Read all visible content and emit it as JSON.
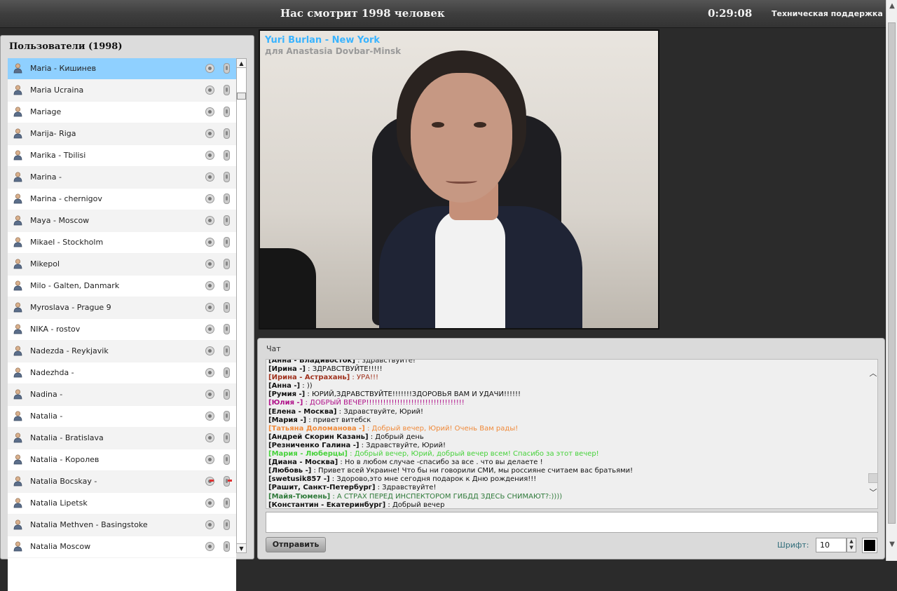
{
  "header": {
    "viewers": "Нас смотрит 1998 человек",
    "timer": "0:29:08",
    "support": "Техническая поддержка"
  },
  "users_panel": {
    "title": "Пользователи (1998)",
    "users": [
      {
        "name": "Maria - Кишинев",
        "selected": true,
        "banned": false
      },
      {
        "name": "Maria Ucraina",
        "selected": false,
        "banned": false
      },
      {
        "name": "Mariage",
        "selected": false,
        "banned": false
      },
      {
        "name": "Marija- Riga",
        "selected": false,
        "banned": false
      },
      {
        "name": "Marika - Tbilisi",
        "selected": false,
        "banned": false
      },
      {
        "name": "Marina -",
        "selected": false,
        "banned": false
      },
      {
        "name": "Marina - chernigov",
        "selected": false,
        "banned": false
      },
      {
        "name": "Maya - Moscow",
        "selected": false,
        "banned": false
      },
      {
        "name": "Mikael - Stockholm",
        "selected": false,
        "banned": false
      },
      {
        "name": "Mikepol",
        "selected": false,
        "banned": false
      },
      {
        "name": "Milo - Galten, Danmark",
        "selected": false,
        "banned": false
      },
      {
        "name": "Myroslava - Prague 9",
        "selected": false,
        "banned": false
      },
      {
        "name": "NIKA - rostov",
        "selected": false,
        "banned": false
      },
      {
        "name": "Nadezda - Reykjavik",
        "selected": false,
        "banned": false
      },
      {
        "name": "Nadezhda -",
        "selected": false,
        "banned": false
      },
      {
        "name": "Nadina -",
        "selected": false,
        "banned": false
      },
      {
        "name": "Natalia -",
        "selected": false,
        "banned": false
      },
      {
        "name": "Natalia - Bratislava",
        "selected": false,
        "banned": false
      },
      {
        "name": "Natalia - Королев",
        "selected": false,
        "banned": false
      },
      {
        "name": "Natalia Bocskay -",
        "selected": false,
        "banned": true
      },
      {
        "name": "Natalia Lipetsk",
        "selected": false,
        "banned": false
      },
      {
        "name": "Natalia Methven - Basingstoke",
        "selected": false,
        "banned": false
      },
      {
        "name": "Natalia Moscow",
        "selected": false,
        "banned": false
      }
    ]
  },
  "video": {
    "broadcaster": "Yuri Burlan - New York",
    "recipient": "для Anastasia Dovbar-Minsk"
  },
  "chat": {
    "title": "Чат",
    "messages": [
      {
        "who": "[Анна - Владивосток]",
        "text": "здравствуйте!",
        "color": "#111111"
      },
      {
        "who": "[Ирина -]",
        "text": "ЗДРАВСТВУЙТЕ!!!!!",
        "color": "#111111"
      },
      {
        "who": "[Ирина - Астрахань]",
        "text": "УРА!!!",
        "color": "#a0321e"
      },
      {
        "who": "[Анна -]",
        "text": "))",
        "color": "#111111"
      },
      {
        "who": "[Румия -]",
        "text": "ЮРИЙ,ЗДРАВСТВУЙТЕ!!!!!!!ЗДОРОВЬЯ ВАМ И УДАЧИ!!!!!!",
        "color": "#111111"
      },
      {
        "who": "[Юлия -]",
        "text": "ДОБРЫЙ ВЕЧЕР!!!!!!!!!!!!!!!!!!!!!!!!!!!!!!!!!!!",
        "color": "#b0128a"
      },
      {
        "who": "[Елена - Москва]",
        "text": "Здравствуйте, Юрий!",
        "color": "#111111"
      },
      {
        "who": "[Мария -]",
        "text": "привет витебск",
        "color": "#111111"
      },
      {
        "who": "[Татьяна Доломанова -]",
        "text": "Добрый вечер, Юрий! Очень Вам рады!",
        "color": "#f08a3a"
      },
      {
        "who": "[Андрей Скорин Казань]",
        "text": "Добрый день",
        "color": "#111111"
      },
      {
        "who": "[Резниченко Галина -]",
        "text": "Здравствуйте, Юрий!",
        "color": "#111111"
      },
      {
        "who": "[Мария - Люберцы]",
        "text": "Добрый вечер, Юрий, добрый вечер всем! Спасибо за этот вечер!",
        "color": "#46d23a"
      },
      {
        "who": "[Диана - Москва]",
        "text": "Но в любом случае -спасибо за все . что вы делаете !",
        "color": "#111111"
      },
      {
        "who": "[Любовь -]",
        "text": "Привет всей Украине! Что бы ни говорили СМИ, мы россияне считаем вас братьями!",
        "color": "#111111"
      },
      {
        "who": "[swetusik857 -]",
        "text": "Здорово,это мне сегодня подарок к Дню рождения!!!",
        "color": "#111111"
      },
      {
        "who": "[Рашит, Санкт-Петербург]",
        "text": "Здравствуйте!",
        "color": "#111111"
      },
      {
        "who": "[Майя-Тюмень]",
        "text": "А СТРАХ ПЕРЕД ИНСПЕКТОРОМ ГИБДД ЗДЕСЬ СНИМАЮТ?:))))",
        "color": "#2f7a3a"
      },
      {
        "who": "[Константин - Екатеринбург]",
        "text": "Добрый вечер",
        "color": "#111111"
      }
    ],
    "input_value": "",
    "send_label": "Отправить",
    "font_label": "Шрифт:",
    "font_size": "10",
    "text_color": "#000000"
  }
}
